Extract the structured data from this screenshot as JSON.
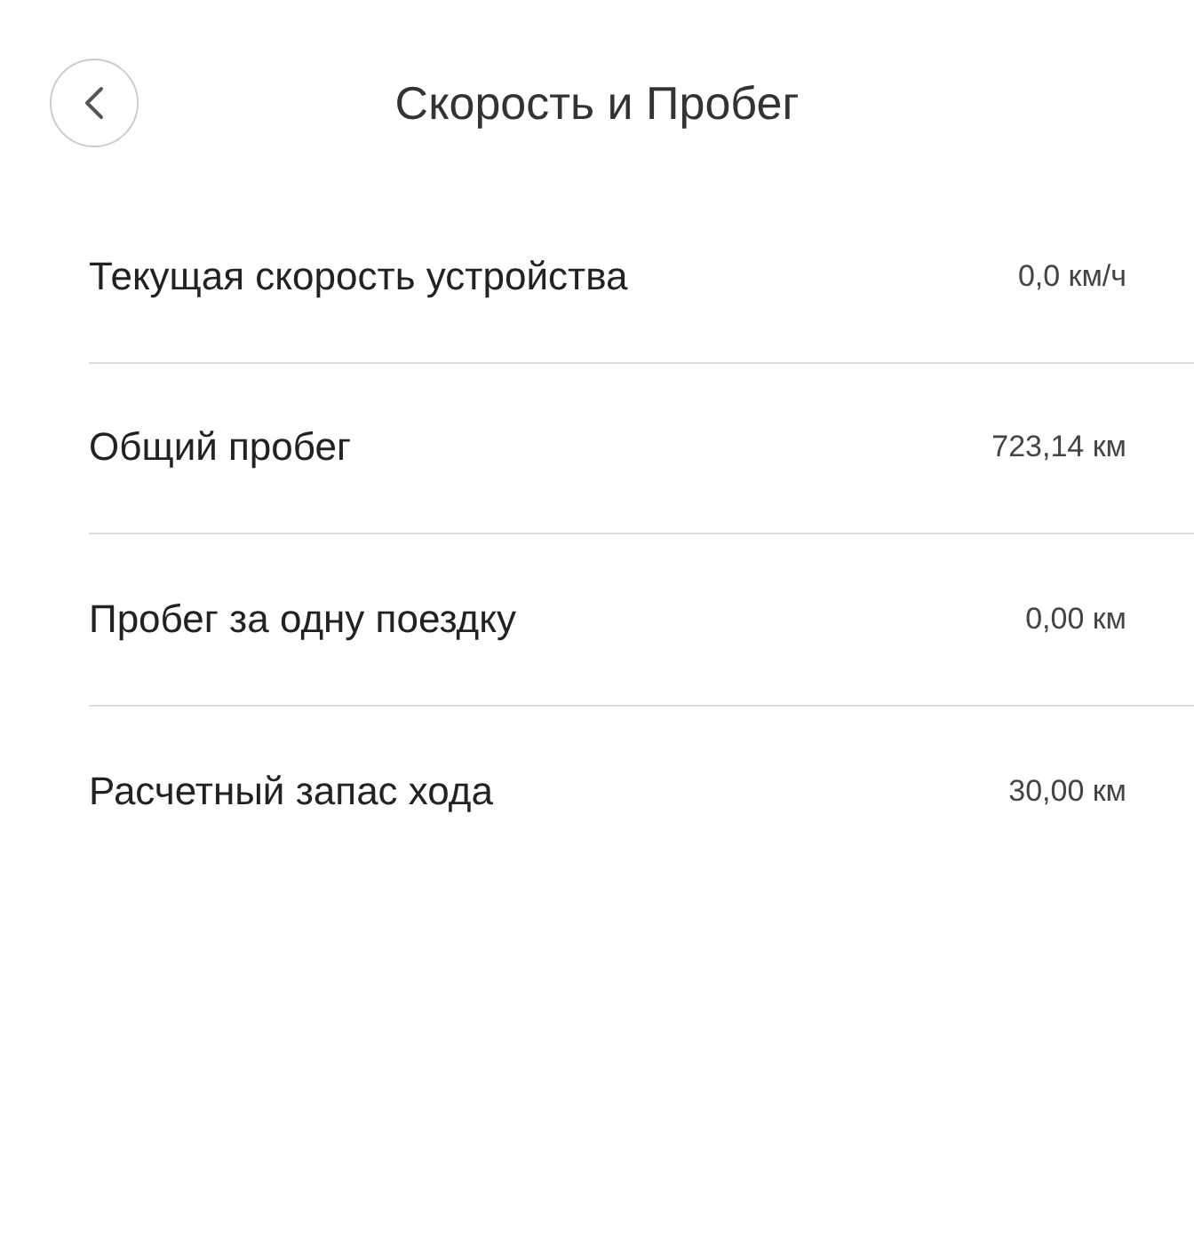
{
  "header": {
    "title": "Скорость и Пробег"
  },
  "rows": [
    {
      "label": "Текущая скорость устройства",
      "value": "0,0 км/ч"
    },
    {
      "label": "Общий пробег",
      "value": "723,14 км"
    },
    {
      "label": "Пробег за одну поездку",
      "value": "0,00 км"
    },
    {
      "label": "Расчетный запас хода",
      "value": "30,00 км"
    }
  ]
}
